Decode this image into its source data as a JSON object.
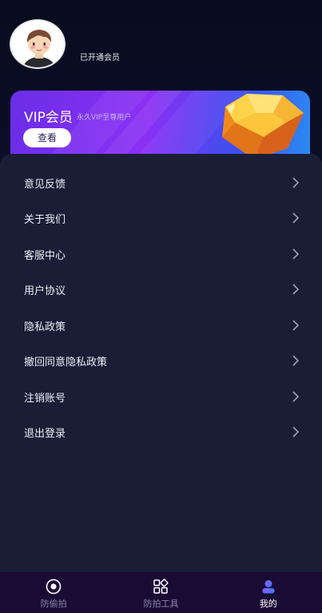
{
  "profile": {
    "avatar_icon": "cartoon-avatar",
    "status_text": "已开通会员"
  },
  "vip_card": {
    "title": "VIP会员",
    "subtitle": "永久VIP至尊用户",
    "button_label": "查看",
    "decoration_icon": "diamond-gem-icon",
    "colors": {
      "start": "#6a2ee8",
      "end": "#2b8cf2"
    }
  },
  "menu": {
    "items": [
      {
        "label": "意见反馈"
      },
      {
        "label": "关于我们"
      },
      {
        "label": "客服中心"
      },
      {
        "label": "用户协议"
      },
      {
        "label": "隐私政策"
      },
      {
        "label": "撤回同意隐私政策"
      },
      {
        "label": "注销账号"
      },
      {
        "label": "退出登录"
      }
    ]
  },
  "tabbar": {
    "tabs": [
      {
        "label": "防偷拍",
        "icon": "camera-lens-icon",
        "active": false
      },
      {
        "label": "防拍工具",
        "icon": "grid-tools-icon",
        "active": false
      },
      {
        "label": "我的",
        "icon": "profile-icon",
        "active": true
      }
    ]
  }
}
